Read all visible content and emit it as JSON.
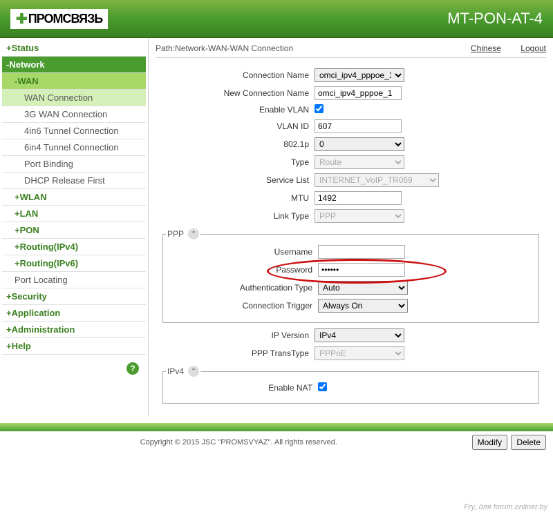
{
  "header": {
    "brand": "ПРОМСВЯЗЬ",
    "model": "MT-PON-AT-4"
  },
  "path": {
    "label": "Path:",
    "value": "Network-WAN-WAN Connection",
    "lang_link": "Chinese",
    "logout": "Logout"
  },
  "sidebar": {
    "status": "Status",
    "network": "Network",
    "wan": "WAN",
    "wan_items": [
      "WAN Connection",
      "3G WAN Connection",
      "4in6 Tunnel Connection",
      "6in4 Tunnel Connection",
      "Port Binding",
      "DHCP Release First"
    ],
    "net_subs": [
      "WLAN",
      "LAN",
      "PON",
      "Routing(IPv4)",
      "Routing(IPv6)"
    ],
    "port_locating": "Port Locating",
    "others": [
      "Security",
      "Application",
      "Administration",
      "Help"
    ]
  },
  "form": {
    "conn_name_label": "Connection Name",
    "conn_name_value": "omci_ipv4_pppoe_1",
    "new_conn_label": "New Connection Name",
    "new_conn_value": "omci_ipv4_pppoe_1",
    "enable_vlan_label": "Enable VLAN",
    "vlan_id_label": "VLAN ID",
    "vlan_id_value": "607",
    "p8021_label": "802.1p",
    "p8021_value": "0",
    "type_label": "Type",
    "type_value": "Route",
    "service_label": "Service List",
    "service_value": "INTERNET_VoIP_TR069",
    "mtu_label": "MTU",
    "mtu_value": "1492",
    "link_label": "Link Type",
    "link_value": "PPP"
  },
  "ppp": {
    "legend": "PPP",
    "username_label": "Username",
    "username_value": "",
    "password_label": "Password",
    "password_value": "••••••",
    "auth_label": "Authentication Type",
    "auth_value": "Auto",
    "trigger_label": "Connection Trigger",
    "trigger_value": "Always On"
  },
  "ip": {
    "version_label": "IP Version",
    "version_value": "IPv4",
    "trans_label": "PPP TransType",
    "trans_value": "PPPoE"
  },
  "ipv4": {
    "legend": "IPv4",
    "nat_label": "Enable NAT"
  },
  "buttons": {
    "modify": "Modify",
    "delete": "Delete"
  },
  "footer": {
    "copyright": "Copyright © 2015 JSC \"PROMSVYAZ\". All rights reserved.",
    "watermark": "Fry, для forum.onliner.by"
  }
}
